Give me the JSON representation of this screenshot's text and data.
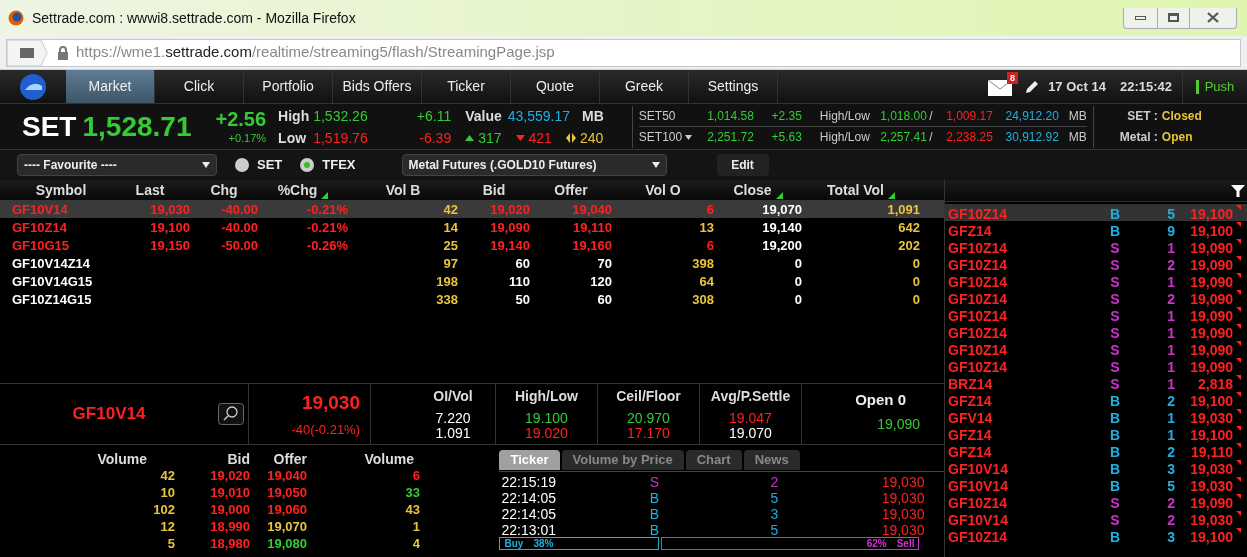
{
  "window": {
    "title": "Settrade.com : wwwi8.settrade.com - Mozilla Firefox"
  },
  "address_bar": {
    "url": "https://wme1.**settrade.com**/realtime/streaming5/flash/StreamingPage.jsp"
  },
  "nav": {
    "tabs": [
      {
        "label": "Market",
        "selected": true
      },
      {
        "label": "Click",
        "selected": false
      },
      {
        "label": "Portfolio",
        "selected": false
      },
      {
        "label": "Bids Offers",
        "selected": false
      },
      {
        "label": "Ticker",
        "selected": false
      },
      {
        "label": "Quote",
        "selected": false
      },
      {
        "label": "Greek",
        "selected": false
      },
      {
        "label": "Settings",
        "selected": false
      }
    ],
    "message_count": "8",
    "date": "17 Oct 14",
    "time": "22:15:42",
    "push": "Push"
  },
  "index": {
    "name": "SET",
    "value": "1,528.71",
    "change": "+2.56",
    "change_pct": "+0.17%",
    "high_label": "High",
    "high": "1,532.26",
    "high_change": "+6.11",
    "low_label": "Low",
    "low": "1,519.76",
    "low_change": "-6.39",
    "value_label": "Value",
    "value_amount": "43,559.17",
    "value_unit": "MB",
    "advances": "317",
    "declines": "421",
    "unchanged": "240"
  },
  "sub_indices": [
    {
      "name": "SET50",
      "has_dropdown": false,
      "value": "1,014.58",
      "change": "+2.35",
      "hl_label": "High/Low",
      "high": "1,018.00",
      "separator": "/",
      "low": "1,009.17",
      "turnover": "24,912.20",
      "unit": "MB"
    },
    {
      "name": "SET100",
      "has_dropdown": true,
      "value": "2,251.72",
      "change": "+5.63",
      "hl_label": "High/Low",
      "high": "2,257.41",
      "separator": "/",
      "low": "2,238.25",
      "turnover": "30,912.92",
      "unit": "MB"
    }
  ],
  "market_status": [
    {
      "label": "SET :",
      "value": "Closed"
    },
    {
      "label": "Metal :",
      "value": "Open"
    }
  ],
  "filter": {
    "favourite": "---- Favourite ----",
    "radios": [
      {
        "label": "SET",
        "selected": false
      },
      {
        "label": "TFEX",
        "selected": true
      }
    ],
    "series": "Metal Futures (.GOLD10 Futures)",
    "edit": "Edit"
  },
  "table": {
    "columns": [
      {
        "label": "Symbol",
        "sorted": false
      },
      {
        "label": "Last",
        "sorted": false
      },
      {
        "label": "Chg",
        "sorted": false
      },
      {
        "label": "%Chg",
        "sorted": true
      },
      {
        "label": "Vol B",
        "sorted": false
      },
      {
        "label": "Bid",
        "sorted": false
      },
      {
        "label": "Offer",
        "sorted": false
      },
      {
        "label": "Vol O",
        "sorted": false
      },
      {
        "label": "Close",
        "sorted": true
      },
      {
        "label": "Total Vol",
        "sorted": true
      }
    ],
    "rows": [
      {
        "selected": true,
        "cells": [
          {
            "text": "GF10V14",
            "color": "#ff2020"
          },
          {
            "text": "19,030",
            "color": "#ff2020"
          },
          {
            "text": "-40.00",
            "color": "#ff2020"
          },
          {
            "text": "-0.21%",
            "color": "#ff2020"
          },
          {
            "text": "42",
            "color": "#e8c53a"
          },
          {
            "text": "19,020",
            "color": "#ff2020"
          },
          {
            "text": "19,040",
            "color": "#ff2020"
          },
          {
            "text": "6",
            "color": "#ff2020"
          },
          {
            "text": "19,070",
            "color": "#ffffff"
          },
          {
            "text": "1,091",
            "color": "#e8c53a"
          }
        ]
      },
      {
        "selected": false,
        "cells": [
          {
            "text": "GF10Z14",
            "color": "#ff2020"
          },
          {
            "text": "19,100",
            "color": "#ff2020"
          },
          {
            "text": "-40.00",
            "color": "#ff2020"
          },
          {
            "text": "-0.21%",
            "color": "#ff2020"
          },
          {
            "text": "14",
            "color": "#e8c53a"
          },
          {
            "text": "19,090",
            "color": "#ff2020"
          },
          {
            "text": "19,110",
            "color": "#ff2020"
          },
          {
            "text": "13",
            "color": "#e8c53a"
          },
          {
            "text": "19,140",
            "color": "#ffffff"
          },
          {
            "text": "642",
            "color": "#e8c53a"
          }
        ]
      },
      {
        "selected": false,
        "cells": [
          {
            "text": "GF10G15",
            "color": "#ff2020"
          },
          {
            "text": "19,150",
            "color": "#ff2020"
          },
          {
            "text": "-50.00",
            "color": "#ff2020"
          },
          {
            "text": "-0.26%",
            "color": "#ff2020"
          },
          {
            "text": "25",
            "color": "#e8c53a"
          },
          {
            "text": "19,140",
            "color": "#ff2020"
          },
          {
            "text": "19,160",
            "color": "#ff2020"
          },
          {
            "text": "6",
            "color": "#ff2020"
          },
          {
            "text": "19,200",
            "color": "#ffffff"
          },
          {
            "text": "202",
            "color": "#e8c53a"
          }
        ]
      },
      {
        "selected": false,
        "cells": [
          {
            "text": "GF10V14Z14",
            "color": "#ffffff"
          },
          null,
          null,
          null,
          {
            "text": "97",
            "color": "#e8c53a"
          },
          {
            "text": "60",
            "color": "#ffffff"
          },
          {
            "text": "70",
            "color": "#ffffff"
          },
          {
            "text": "398",
            "color": "#e8c53a"
          },
          {
            "text": "0",
            "color": "#ffffff"
          },
          {
            "text": "0",
            "color": "#e8c53a"
          }
        ]
      },
      {
        "selected": false,
        "cells": [
          {
            "text": "GF10V14G15",
            "color": "#ffffff"
          },
          null,
          null,
          null,
          {
            "text": "198",
            "color": "#e8c53a"
          },
          {
            "text": "110",
            "color": "#ffffff"
          },
          {
            "text": "120",
            "color": "#ffffff"
          },
          {
            "text": "64",
            "color": "#e8c53a"
          },
          {
            "text": "0",
            "color": "#ffffff"
          },
          {
            "text": "0",
            "color": "#e8c53a"
          }
        ]
      },
      {
        "selected": false,
        "cells": [
          {
            "text": "GF10Z14G15",
            "color": "#ffffff"
          },
          null,
          null,
          null,
          {
            "text": "338",
            "color": "#e8c53a"
          },
          {
            "text": "50",
            "color": "#ffffff"
          },
          {
            "text": "60",
            "color": "#ffffff"
          },
          {
            "text": "308",
            "color": "#e8c53a"
          },
          {
            "text": "0",
            "color": "#ffffff"
          },
          {
            "text": "0",
            "color": "#e8c53a"
          }
        ]
      }
    ]
  },
  "quote": {
    "symbol": "GF10V14",
    "last": "19,030",
    "change": "-40(-0.21%)",
    "stats": [
      {
        "label": "OI/Vol",
        "values": [
          {
            "text": "7.220",
            "color": "#ffffff"
          },
          {
            "text": "1.091",
            "color": "#ffffff"
          }
        ]
      },
      {
        "label": "High/Low",
        "values": [
          {
            "text": "19.100",
            "color": "#33cc33"
          },
          {
            "text": "19.020",
            "color": "#ff2020"
          }
        ]
      },
      {
        "label": "Ceil/Floor",
        "values": [
          {
            "text": "20.970",
            "color": "#33cc33"
          },
          {
            "text": "17.170",
            "color": "#ff2020"
          }
        ]
      },
      {
        "label": "Avg/P.Settle",
        "values": [
          {
            "text": "19.047",
            "color": "#ff2020"
          },
          {
            "text": "19.070",
            "color": "#ffffff"
          }
        ]
      }
    ],
    "open_label": "Open 0",
    "open_value": "19,090"
  },
  "depth": {
    "columns": [
      "Volume",
      "Bid",
      "Offer",
      "Volume"
    ],
    "rows": [
      [
        {
          "text": "42",
          "color": "#e8c53a"
        },
        {
          "text": "19,020",
          "color": "#ff2020"
        },
        {
          "text": "19,040",
          "color": "#ff2020"
        },
        {
          "text": "6",
          "color": "#ff2020"
        }
      ],
      [
        {
          "text": "10",
          "color": "#e8c53a"
        },
        {
          "text": "19,010",
          "color": "#ff2020"
        },
        {
          "text": "19,050",
          "color": "#ff2020"
        },
        {
          "text": "33",
          "color": "#33cc33"
        }
      ],
      [
        {
          "text": "102",
          "color": "#e8c53a"
        },
        {
          "text": "19,000",
          "color": "#ff2020"
        },
        {
          "text": "19,060",
          "color": "#ff2020"
        },
        {
          "text": "43",
          "color": "#e8c53a"
        }
      ],
      [
        {
          "text": "12",
          "color": "#e8c53a"
        },
        {
          "text": "18,990",
          "color": "#ff2020"
        },
        {
          "text": "19,070",
          "color": "#e8c53a"
        },
        {
          "text": "1",
          "color": "#e8c53a"
        }
      ],
      [
        {
          "text": "5",
          "color": "#e8c53a"
        },
        {
          "text": "18,980",
          "color": "#ff2020"
        },
        {
          "text": "19,080",
          "color": "#33cc33"
        },
        {
          "text": "4",
          "color": "#e8c53a"
        }
      ]
    ]
  },
  "detail_tabs": [
    {
      "label": "Ticker",
      "selected": true
    },
    {
      "label": "Volume by Price",
      "selected": false
    },
    {
      "label": "Chart",
      "selected": false
    },
    {
      "label": "News",
      "selected": false
    }
  ],
  "ticker": {
    "rows": [
      [
        {
          "text": "22:15:19",
          "color": "#ffffff"
        },
        {
          "text": "S",
          "color": "#d030d0"
        },
        {
          "text": "2",
          "color": "#d030d0"
        },
        {
          "text": "19,030",
          "color": "#ff2020"
        }
      ],
      [
        {
          "text": "22:14:05",
          "color": "#ffffff"
        },
        {
          "text": "B",
          "color": "#20b0e0"
        },
        {
          "text": "5",
          "color": "#20b0e0"
        },
        {
          "text": "19,030",
          "color": "#ff2020"
        }
      ],
      [
        {
          "text": "22:14:05",
          "color": "#ffffff"
        },
        {
          "text": "B",
          "color": "#20b0e0"
        },
        {
          "text": "3",
          "color": "#20b0e0"
        },
        {
          "text": "19,030",
          "color": "#ff2020"
        }
      ],
      [
        {
          "text": "22:13:01",
          "color": "#ffffff"
        },
        {
          "text": "B",
          "color": "#20b0e0"
        },
        {
          "text": "5",
          "color": "#20b0e0"
        },
        {
          "text": "19,030",
          "color": "#ff2020"
        }
      ]
    ],
    "buy_label": "Buy",
    "buy_pct": "38%",
    "sell_pct": "62%",
    "sell_label": "Sell",
    "level": 0.38
  },
  "trades": [
    {
      "selected": true,
      "cells": [
        {
          "text": "GF10Z14",
          "color": "#ff2020"
        },
        {
          "text": "B",
          "color": "#20b0e0"
        },
        {
          "text": "5",
          "color": "#20b0e0"
        },
        {
          "text": "19,100",
          "color": "#ff2020"
        }
      ]
    },
    {
      "selected": false,
      "cells": [
        {
          "text": "GFZ14",
          "color": "#ff2020"
        },
        {
          "text": "B",
          "color": "#20b0e0"
        },
        {
          "text": "9",
          "color": "#20b0e0"
        },
        {
          "text": "19,100",
          "color": "#ff2020"
        }
      ]
    },
    {
      "selected": false,
      "cells": [
        {
          "text": "GF10Z14",
          "color": "#ff2020"
        },
        {
          "text": "S",
          "color": "#d030d0"
        },
        {
          "text": "1",
          "color": "#d030d0"
        },
        {
          "text": "19,090",
          "color": "#ff2020"
        }
      ]
    },
    {
      "selected": false,
      "cells": [
        {
          "text": "GF10Z14",
          "color": "#ff2020"
        },
        {
          "text": "S",
          "color": "#d030d0"
        },
        {
          "text": "2",
          "color": "#d030d0"
        },
        {
          "text": "19,090",
          "color": "#ff2020"
        }
      ]
    },
    {
      "selected": false,
      "cells": [
        {
          "text": "GF10Z14",
          "color": "#ff2020"
        },
        {
          "text": "S",
          "color": "#d030d0"
        },
        {
          "text": "1",
          "color": "#d030d0"
        },
        {
          "text": "19,090",
          "color": "#ff2020"
        }
      ]
    },
    {
      "selected": false,
      "cells": [
        {
          "text": "GF10Z14",
          "color": "#ff2020"
        },
        {
          "text": "S",
          "color": "#d030d0"
        },
        {
          "text": "2",
          "color": "#d030d0"
        },
        {
          "text": "19,090",
          "color": "#ff2020"
        }
      ]
    },
    {
      "selected": false,
      "cells": [
        {
          "text": "GF10Z14",
          "color": "#ff2020"
        },
        {
          "text": "S",
          "color": "#d030d0"
        },
        {
          "text": "1",
          "color": "#d030d0"
        },
        {
          "text": "19,090",
          "color": "#ff2020"
        }
      ]
    },
    {
      "selected": false,
      "cells": [
        {
          "text": "GF10Z14",
          "color": "#ff2020"
        },
        {
          "text": "S",
          "color": "#d030d0"
        },
        {
          "text": "1",
          "color": "#d030d0"
        },
        {
          "text": "19,090",
          "color": "#ff2020"
        }
      ]
    },
    {
      "selected": false,
      "cells": [
        {
          "text": "GF10Z14",
          "color": "#ff2020"
        },
        {
          "text": "S",
          "color": "#d030d0"
        },
        {
          "text": "1",
          "color": "#d030d0"
        },
        {
          "text": "19,090",
          "color": "#ff2020"
        }
      ]
    },
    {
      "selected": false,
      "cells": [
        {
          "text": "GF10Z14",
          "color": "#ff2020"
        },
        {
          "text": "S",
          "color": "#d030d0"
        },
        {
          "text": "1",
          "color": "#d030d0"
        },
        {
          "text": "19,090",
          "color": "#ff2020"
        }
      ]
    },
    {
      "selected": false,
      "cells": [
        {
          "text": "BRZ14",
          "color": "#ff2020"
        },
        {
          "text": "S",
          "color": "#d030d0"
        },
        {
          "text": "1",
          "color": "#d030d0"
        },
        {
          "text": "2,818",
          "color": "#ff2020"
        }
      ]
    },
    {
      "selected": false,
      "cells": [
        {
          "text": "GFZ14",
          "color": "#ff2020"
        },
        {
          "text": "B",
          "color": "#20b0e0"
        },
        {
          "text": "2",
          "color": "#20b0e0"
        },
        {
          "text": "19,100",
          "color": "#ff2020"
        }
      ]
    },
    {
      "selected": false,
      "cells": [
        {
          "text": "GFV14",
          "color": "#ff2020"
        },
        {
          "text": "B",
          "color": "#20b0e0"
        },
        {
          "text": "1",
          "color": "#20b0e0"
        },
        {
          "text": "19,030",
          "color": "#ff2020"
        }
      ]
    },
    {
      "selected": false,
      "cells": [
        {
          "text": "GFZ14",
          "color": "#ff2020"
        },
        {
          "text": "B",
          "color": "#20b0e0"
        },
        {
          "text": "1",
          "color": "#20b0e0"
        },
        {
          "text": "19,100",
          "color": "#ff2020"
        }
      ]
    },
    {
      "selected": false,
      "cells": [
        {
          "text": "GFZ14",
          "color": "#ff2020"
        },
        {
          "text": "B",
          "color": "#20b0e0"
        },
        {
          "text": "2",
          "color": "#20b0e0"
        },
        {
          "text": "19,110",
          "color": "#ff2020"
        }
      ]
    },
    {
      "selected": false,
      "cells": [
        {
          "text": "GF10V14",
          "color": "#ff2020"
        },
        {
          "text": "B",
          "color": "#20b0e0"
        },
        {
          "text": "3",
          "color": "#20b0e0"
        },
        {
          "text": "19,030",
          "color": "#ff2020"
        }
      ]
    },
    {
      "selected": false,
      "cells": [
        {
          "text": "GF10V14",
          "color": "#ff2020"
        },
        {
          "text": "B",
          "color": "#20b0e0"
        },
        {
          "text": "5",
          "color": "#20b0e0"
        },
        {
          "text": "19,030",
          "color": "#ff2020"
        }
      ]
    },
    {
      "selected": false,
      "cells": [
        {
          "text": "GF10Z14",
          "color": "#ff2020"
        },
        {
          "text": "S",
          "color": "#d030d0"
        },
        {
          "text": "2",
          "color": "#d030d0"
        },
        {
          "text": "19,090",
          "color": "#ff2020"
        }
      ]
    },
    {
      "selected": false,
      "cells": [
        {
          "text": "GF10V14",
          "color": "#ff2020"
        },
        {
          "text": "S",
          "color": "#d030d0"
        },
        {
          "text": "2",
          "color": "#d030d0"
        },
        {
          "text": "19,030",
          "color": "#ff2020"
        }
      ]
    },
    {
      "selected": false,
      "cells": [
        {
          "text": "GF10Z14",
          "color": "#ff2020"
        },
        {
          "text": "B",
          "color": "#20b0e0"
        },
        {
          "text": "3",
          "color": "#20b0e0"
        },
        {
          "text": "19,100",
          "color": "#ff2020"
        }
      ]
    }
  ]
}
